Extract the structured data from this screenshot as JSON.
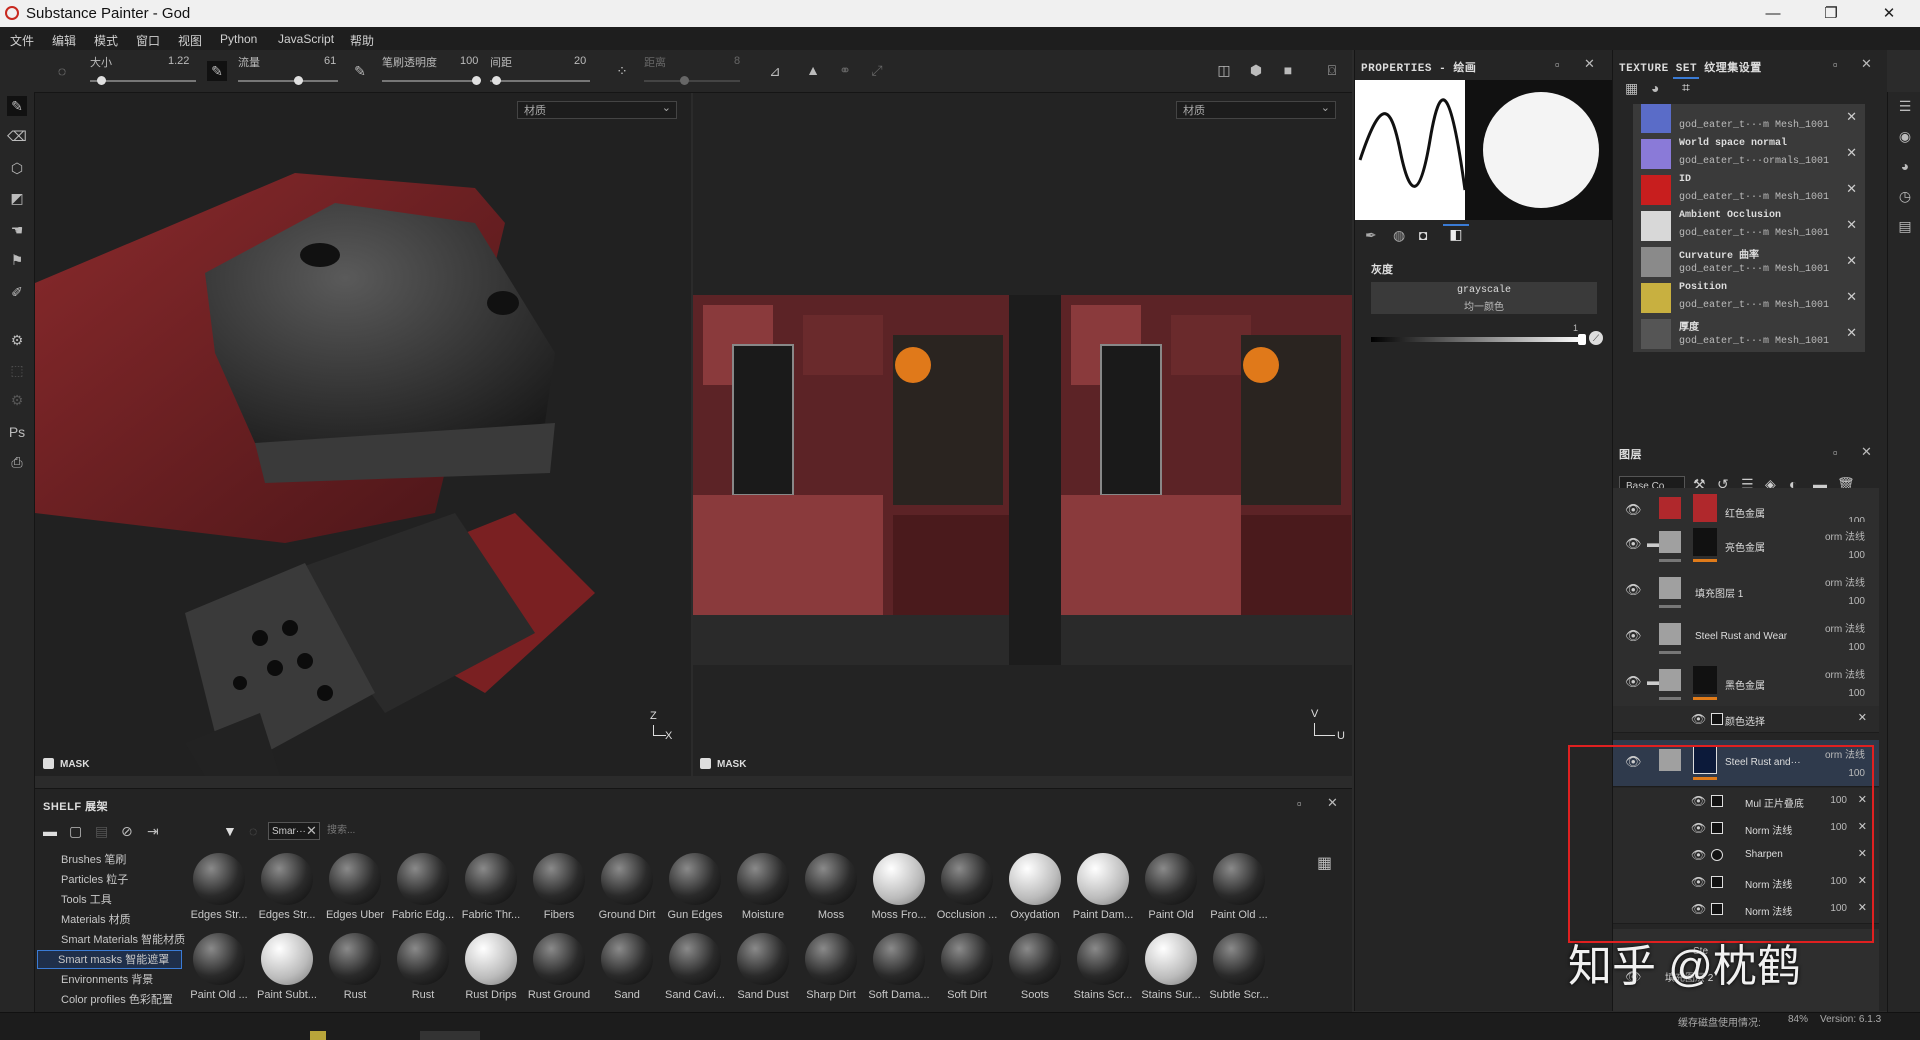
{
  "window": {
    "title": "Substance Painter - God",
    "minimize": "—",
    "restore": "❐",
    "close": "✕"
  },
  "menu": [
    "文件",
    "编辑",
    "模式",
    "窗口",
    "视图",
    "Python",
    "JavaScript",
    "帮助"
  ],
  "tool_settings": {
    "size_label": "大小",
    "size_value": "1.22",
    "flow_label": "流量",
    "flow_value": "61",
    "stroke_opacity_label": "笔刷透明度",
    "stroke_opacity_value": "100",
    "spacing_label": "间距",
    "spacing_value": "20",
    "distance_label": "距离",
    "distance_value": "8"
  },
  "viewport_3d": {
    "channel_select": "材质",
    "mask_label": "MASK",
    "axis_z": "Z",
    "axis_x": "X"
  },
  "viewport_2d": {
    "channel_select": "材质",
    "mask_label": "MASK",
    "axis_v": "V",
    "axis_u": "U"
  },
  "shelf": {
    "title": "SHELF 展架",
    "filter_chip": "Smar···",
    "search_placeholder": "搜索...",
    "categories": [
      "Brushes 笔刷",
      "Particles 粒子",
      "Tools 工具",
      "Materials 材质",
      "Smart Materials 智能材质",
      "Smart masks 智能遮罩",
      "Environments 背景",
      "Color profiles 色彩配置"
    ],
    "selected_category": "Smart masks 智能遮罩",
    "items_row1": [
      "Edges Str...",
      "Edges Str...",
      "Edges Uber",
      "Fabric Edg...",
      "Fabric Thr...",
      "Fibers",
      "Ground Dirt",
      "Gun Edges",
      "Moisture",
      "Moss",
      "Moss Fro...",
      "Occlusion ...",
      "Oxydation",
      "Paint Dam...",
      "Paint Old",
      "Paint Old ..."
    ],
    "items_row2": [
      "Paint Old ...",
      "Paint Subt...",
      "Rust",
      "Rust",
      "Rust Drips",
      "Rust Ground",
      "Sand",
      "Sand Cavi...",
      "Sand Dust",
      "Sharp Dirt",
      "Soft Dama...",
      "Soft Dirt",
      "Soots",
      "Stains Scr...",
      "Stains Sur...",
      "Subtle Scr..."
    ]
  },
  "properties": {
    "title": "PROPERTIES - 绘画",
    "section": "灰度",
    "grayscale_label": "grayscale",
    "grayscale_sub": "均一颜色",
    "slider_value": "1",
    "slider_level": 1
  },
  "texture_set": {
    "title": "TEXTURE SET 纹理集设置",
    "maps": [
      {
        "name": "",
        "file": "god_eater_t···m Mesh_1001",
        "color": "#5a6cc8"
      },
      {
        "name": "World space normal",
        "file": "god_eater_t···ormals_1001",
        "color": "#8a7ad8"
      },
      {
        "name": "ID",
        "file": "god_eater_t···m Mesh_1001",
        "color": "#c81e1e"
      },
      {
        "name": "Ambient Occlusion",
        "file": "god_eater_t···m Mesh_1001",
        "color": "#d8d8d8"
      },
      {
        "name": "Curvature 曲率",
        "file": "god_eater_t···m Mesh_1001",
        "color": "#8a8a8a"
      },
      {
        "name": "Position",
        "file": "god_eater_t···m Mesh_1001",
        "color": "#c8b040"
      },
      {
        "name": "厚度",
        "file": "god_eater_t···m Mesh_1001",
        "color": "#555555"
      }
    ]
  },
  "layers": {
    "title": "图层",
    "blend_select": "Base Co",
    "items": [
      {
        "name": "红色金属",
        "blend": "",
        "opacity": "100"
      },
      {
        "name": "亮色金属",
        "blend": "orm 法线",
        "opacity": "100"
      },
      {
        "name": "填充图层 1",
        "blend": "orm 法线",
        "opacity": "100"
      },
      {
        "name": "Steel Rust and Wear",
        "blend": "orm 法线",
        "opacity": "100"
      },
      {
        "name": "黑色金属",
        "blend": "orm 法线",
        "opacity": "100"
      }
    ],
    "color_select_effect": "颜色选择",
    "selected_layer": {
      "name": "Steel Rust and···",
      "blend": "orm 法线",
      "opacity": "100"
    },
    "effects": [
      {
        "name": "Mul 正片叠底",
        "value": "100"
      },
      {
        "name": "Norm 法线",
        "value": "100"
      },
      {
        "name": "Sharpen",
        "value": ""
      },
      {
        "name": "Norm 法线",
        "value": "100"
      },
      {
        "name": "Norm 法线",
        "value": "100"
      }
    ],
    "below_1": "Ste",
    "below_2": "填充图层 2"
  },
  "status": {
    "cache": "缓存磁盘使用情况:",
    "percent": "84%",
    "version": "Version: 6.1.3"
  },
  "watermark": "知乎 @枕鹤",
  "colors": {
    "accent": "#3a7bd5",
    "highlight_box": "#e02020",
    "orange": "#e07b1a"
  }
}
